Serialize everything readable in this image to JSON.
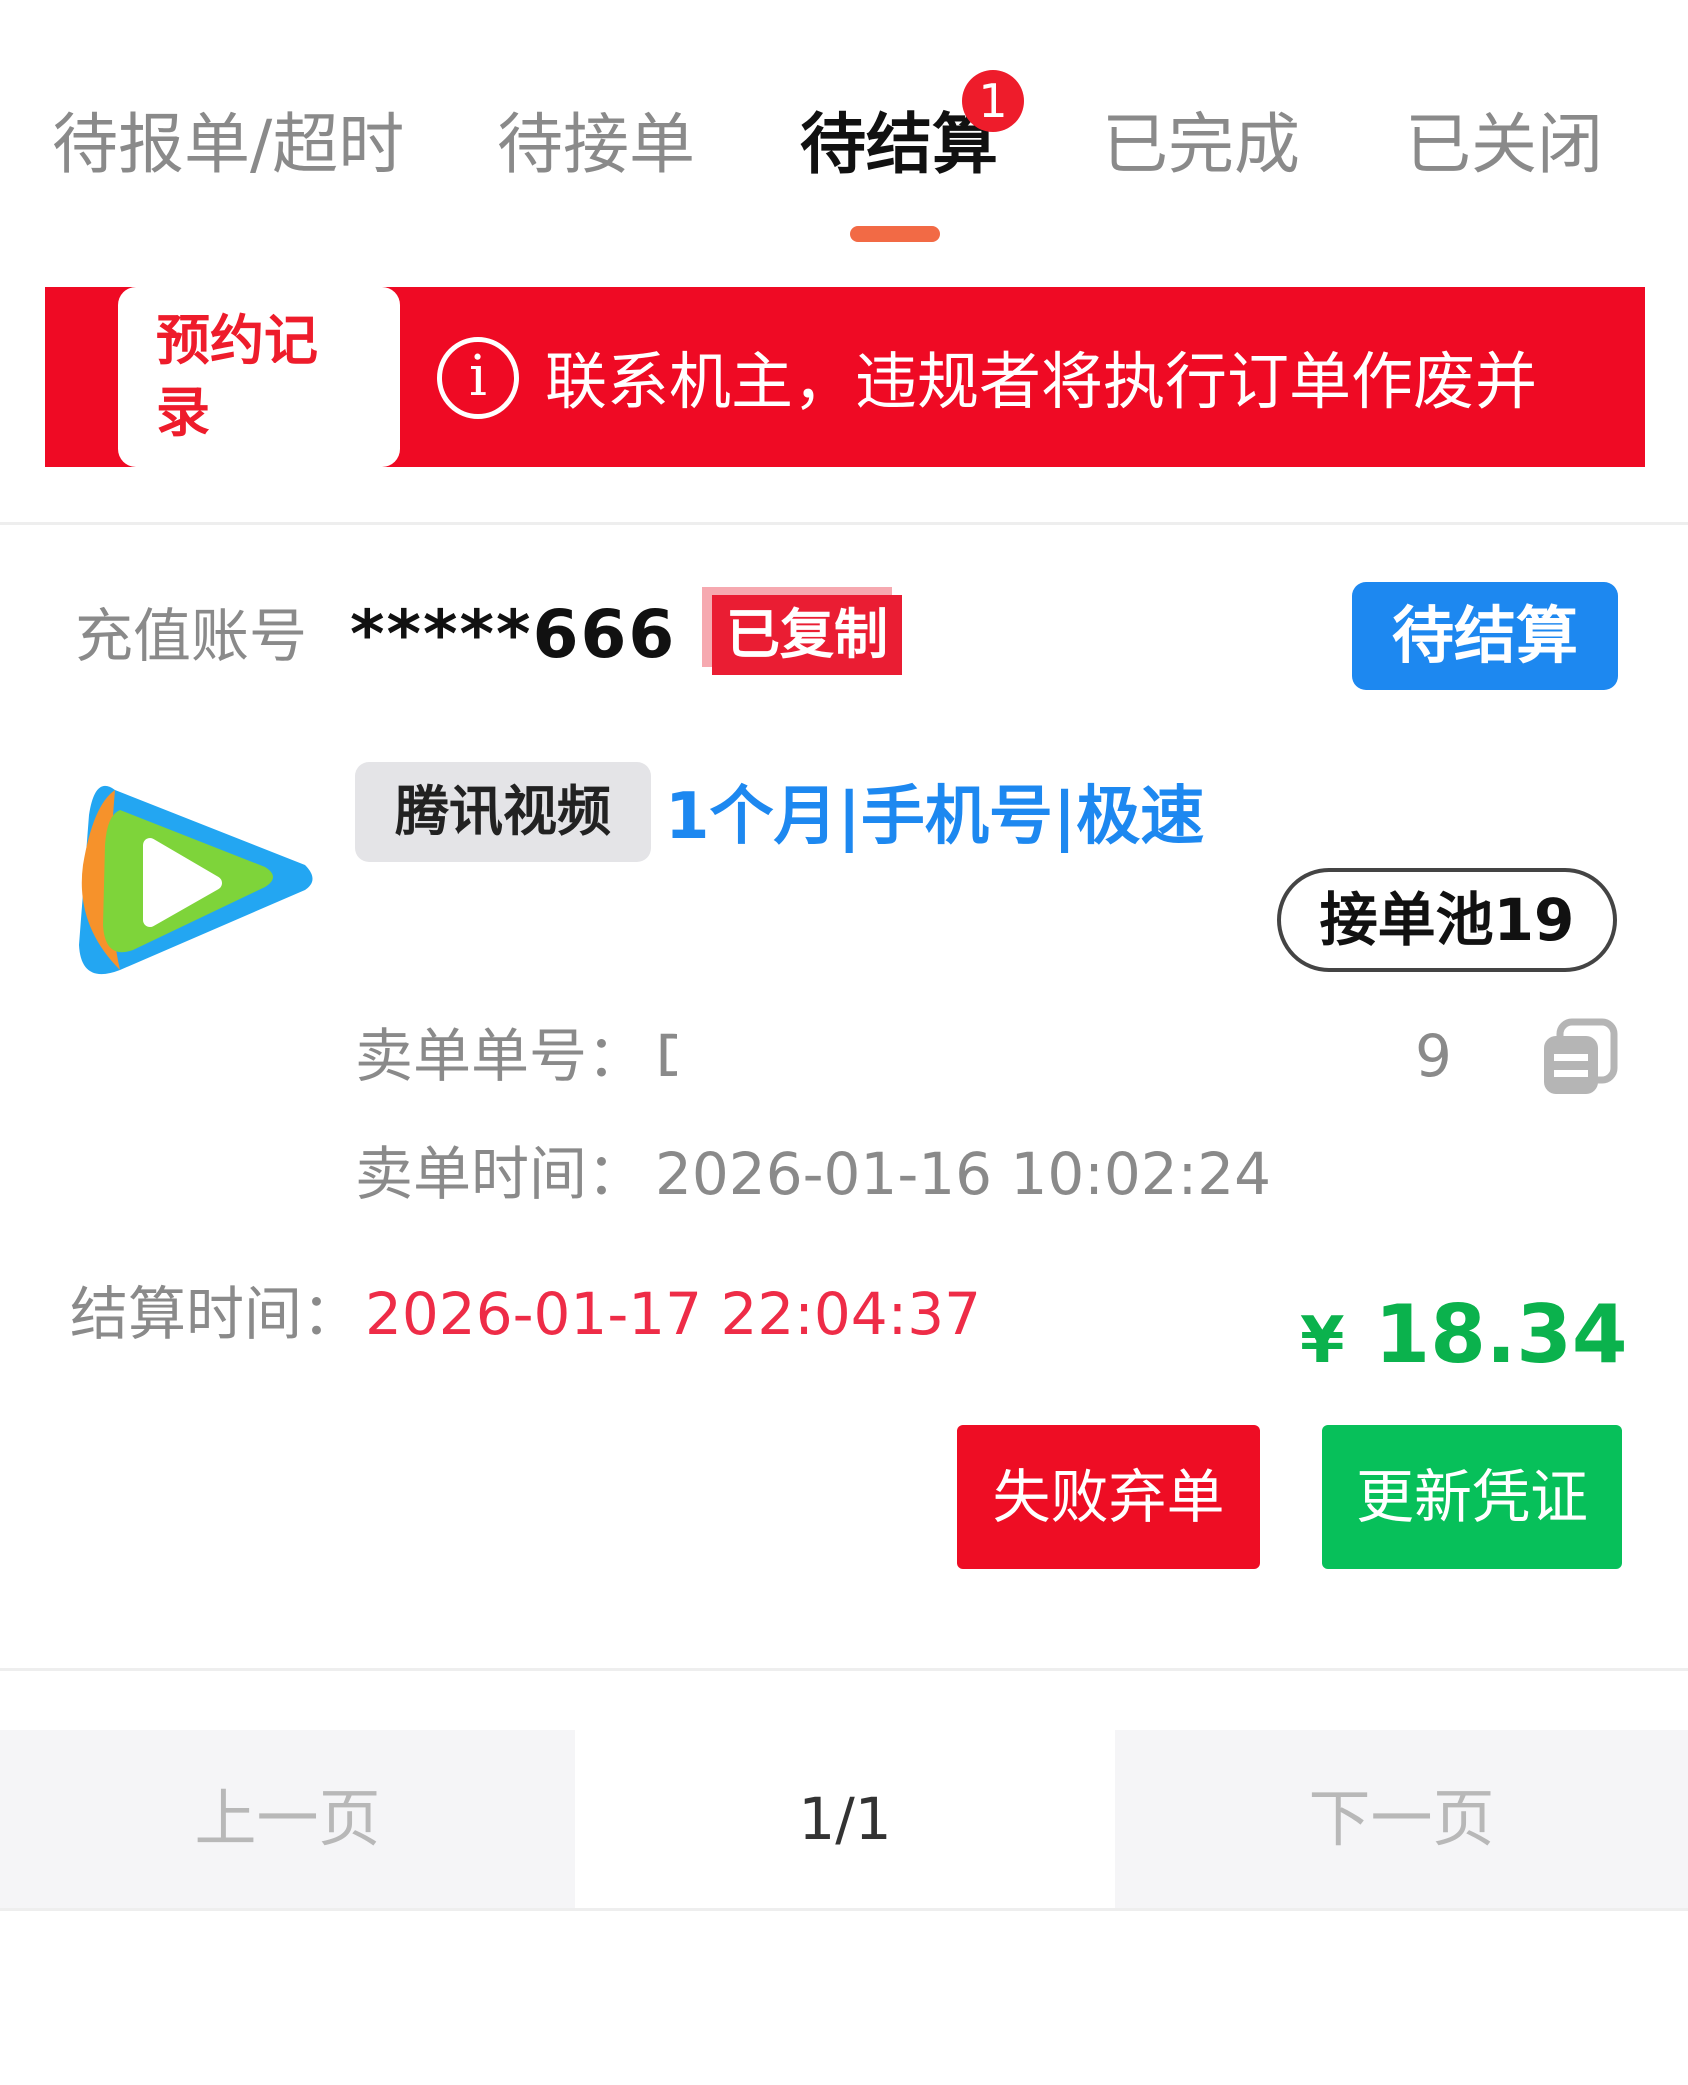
{
  "tabs": [
    {
      "label": "待报单/超时"
    },
    {
      "label": "待接单"
    },
    {
      "label": "待结算",
      "active": true,
      "badge": "1"
    },
    {
      "label": "已完成"
    },
    {
      "label": "已关闭"
    }
  ],
  "notice": {
    "reserve_button": "预约记录",
    "text": "联系机主，违规者将执行订单作废并"
  },
  "order": {
    "account_label": "充值账号",
    "account_value": "*****666",
    "copied_badge": "已复制",
    "status": "待结算",
    "app_icon": "tencent-video-logo",
    "product_tag": "腾讯视频",
    "product_spec": "1个月|手机号|极速",
    "pool_badge": "接单池19",
    "order_no_label": "卖单单号：",
    "order_no_value_head": "D",
    "order_no_value_tail": "9",
    "sell_time_label": "卖单时间：",
    "sell_time_value": "2026-01-16 10:02:24",
    "settle_time_label": "结算时间：",
    "settle_time_value": "2026-01-17 22:04:37",
    "price_symbol": "¥",
    "price_value": "18.34",
    "fail_button": "失败弃单",
    "update_button": "更新凭证"
  },
  "pagination": {
    "prev": "上一页",
    "current": "1/1",
    "next": "下一页"
  },
  "colors": {
    "accent_red": "#ee0d24",
    "status_blue": "#1d88f0",
    "price_green": "#0bb24d"
  }
}
